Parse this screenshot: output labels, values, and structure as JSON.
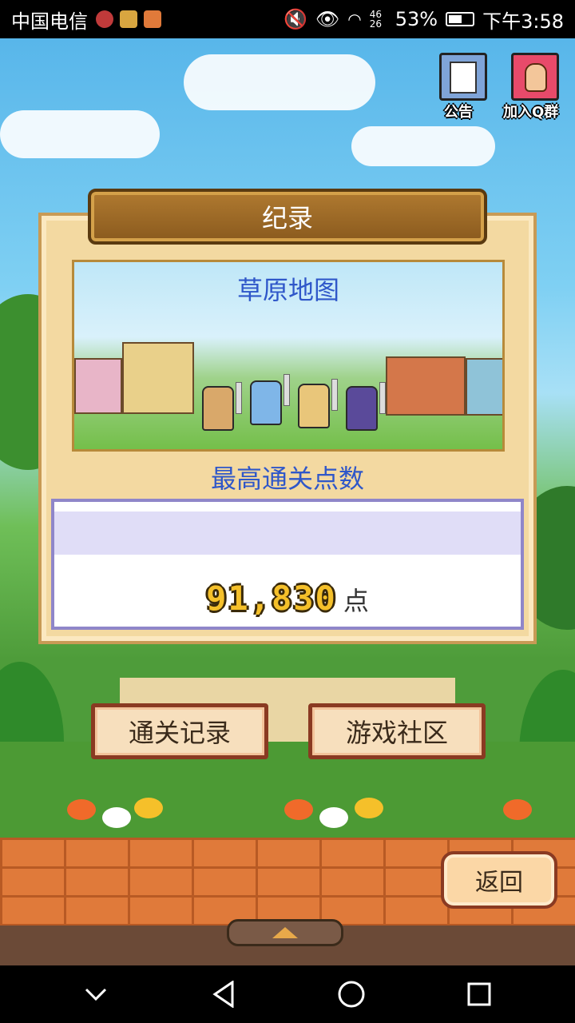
{
  "status_bar": {
    "carrier": "中国电信",
    "network": "46 26",
    "battery": "53%",
    "time": "下午3:58"
  },
  "top_icons": {
    "notice_label": "公告",
    "qq_label": "加入Q群"
  },
  "record_panel": {
    "title": "纪录",
    "map_name": "草原地图",
    "score_label": "最高通关点数",
    "score_value": "91,830",
    "score_unit": "点"
  },
  "buttons": {
    "clear_record": "通关记录",
    "community": "游戏社区",
    "back": "返回"
  },
  "colors": {
    "label_blue": "#2f57c9",
    "panel_bg": "#f3d9a1",
    "score_gold": "#f5c02a"
  }
}
